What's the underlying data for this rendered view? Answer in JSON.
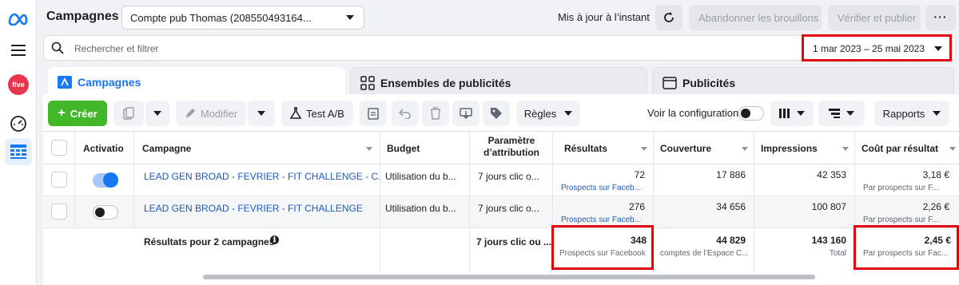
{
  "sidebar": {
    "icons": [
      "meta-logo",
      "menu-icon",
      "five-logo",
      "dashboard-icon",
      "table-icon"
    ],
    "five_label": "five"
  },
  "header": {
    "title": "Campagnes",
    "account_selector": "Compte pub Thomas (208550493164...",
    "updated_text": "Mis à jour à l’instant",
    "discard_label": "Abandonner les brouillons",
    "publish_label": "Vérifier et publier",
    "more_label": "···"
  },
  "search": {
    "placeholder": "Rechercher et filtrer",
    "date_range": "1 mar 2023 – 25 mai 2023"
  },
  "tabs": [
    {
      "label": "Campagnes",
      "active": true
    },
    {
      "label": "Ensembles de publicités",
      "active": false
    },
    {
      "label": "Publicités",
      "active": false
    }
  ],
  "toolbar": {
    "create_label": "Créer",
    "edit_label": "Modifier",
    "ab_test_label": "Test A/B",
    "rules_label": "Règles",
    "view_setup_label": "Voir la configuration",
    "reports_label": "Rapports"
  },
  "table": {
    "columns": [
      "Activatio",
      "Campagne",
      "Budget",
      "Paramètre",
      "d’attribution",
      "Résultats",
      "Couverture",
      "Impressions",
      "Coût par résultat"
    ],
    "rows": [
      {
        "active": true,
        "campaign": "LEAD GEN BROAD - FEVRIER - FIT CHALLENGE - C...",
        "budget": "Utilisation du b...",
        "attribution": "7 jours clic o...",
        "results": "72",
        "results_sub": "Prospects sur Faceb...",
        "reach": "17 886",
        "impressions": "42 353",
        "cost": "3,18 €",
        "cost_sub": "Par prospects sur F..."
      },
      {
        "active": false,
        "campaign": "LEAD GEN BROAD - FEVRIER - FIT CHALLENGE",
        "budget": "Utilisation du b...",
        "attribution": "7 jours clic o...",
        "results": "276",
        "results_sub": "Prospects sur Faceb...",
        "reach": "34 656",
        "impressions": "100 807",
        "cost": "2,26 €",
        "cost_sub": "Par prospects sur F..."
      }
    ],
    "summary": {
      "label": "Résultats pour 2 campagnes",
      "info_icon": "ℹ",
      "attribution": "7 jours clic ou ...",
      "results": "348",
      "results_sub": "Prospects sur Facebook",
      "reach": "44 829",
      "reach_sub": "comptes de l’Espace C...",
      "impressions": "143 160",
      "impressions_sub": "Total",
      "cost": "2,45 €",
      "cost_sub": "Par prospects sur Fac..."
    }
  },
  "colors": {
    "accent": "#1877f2",
    "create": "#42b72a",
    "highlight": "#e4000f"
  }
}
